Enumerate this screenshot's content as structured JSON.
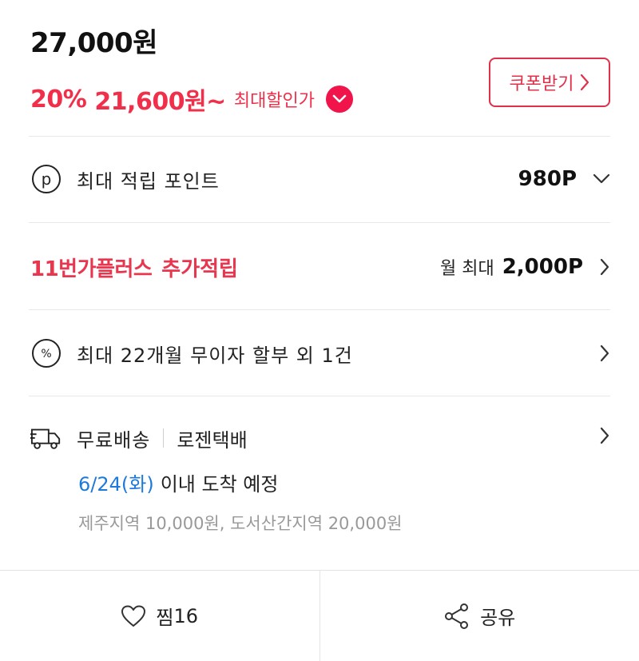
{
  "price": {
    "original": "27,000원",
    "discount_percent": "20%",
    "sale_price": "21,600원~",
    "sale_label": "최대할인가",
    "coupon_button": "쿠폰받기"
  },
  "points": {
    "label": "최대 적립 포인트",
    "value": "980P"
  },
  "plus": {
    "title": "11번가플러스",
    "subtitle": "추가적립",
    "value_label": "월 최대",
    "value": "2,000P"
  },
  "installment": {
    "label": "최대 22개월 무이자 할부 외 1건"
  },
  "delivery": {
    "type": "무료배송",
    "courier": "로젠택배",
    "arrival_date": "6/24(화)",
    "arrival_text": "이내 도착 예정",
    "extra_fee": "제주지역 10,000원, 도서산간지역 20,000원"
  },
  "bottom": {
    "like_label": "찜",
    "like_count": "16",
    "share_label": "공유"
  },
  "colors": {
    "accent_red": "#f0304a",
    "link_blue": "#1e7ad9"
  }
}
